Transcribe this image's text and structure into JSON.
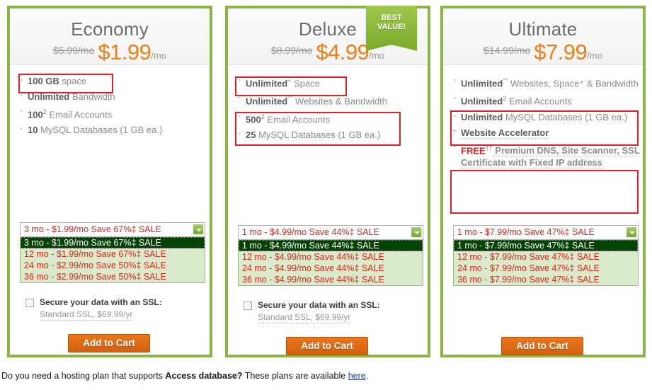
{
  "ribbon": {
    "line1": "BEST",
    "line2": "VALUE!"
  },
  "plans": [
    {
      "id": "economy",
      "name": "Economy",
      "old_price": "$5.99/mo",
      "price": "$1.99",
      "per": "/mo",
      "features": [
        {
          "strong": "100 GB",
          "rest": " space"
        },
        {
          "strong": "Unlimited",
          "rest": " Bandwidth"
        },
        {
          "strong": "100",
          "rest": " Email Accounts",
          "sup": "2"
        },
        {
          "strong": "10",
          "rest": " MySQL Databases (1 GB ea.)"
        }
      ],
      "selected_term": "3 mo   - $1.99/mo Save 67%‡ SALE",
      "terms": [
        "3 mo   - $1.99/mo Save 67%‡ SALE",
        "12 mo - $1.99/mo Save 67%‡ SALE",
        "24 mo - $2.99/mo Save 50%‡ SALE",
        "36 mo - $2.99/mo Save 50%‡ SALE"
      ],
      "ssl_label": "Secure your data with an SSL:",
      "ssl_sub": "Standard SSL, $69.99/yr",
      "cart_label": "Add to Cart"
    },
    {
      "id": "deluxe",
      "name": "Deluxe",
      "old_price": "$8.99/mo",
      "price": "$4.99",
      "per": "/mo",
      "features": [
        {
          "strong": "Unlimited",
          "rest": " Space",
          "sup": "+"
        },
        {
          "strong": "Unlimited",
          "rest": " Websites",
          "sup": "°°",
          "tail": " & Bandwidth"
        },
        {
          "strong": "500",
          "rest": " Email Accounts",
          "sup": "2"
        },
        {
          "strong": "25",
          "rest": " MySQL Databases (1 GB ea.)"
        }
      ],
      "selected_term": "1 mo   - $4.99/mo Save 44%‡ SALE",
      "terms": [
        "1 mo   - $4.99/mo Save 44%‡ SALE",
        "12 mo - $4.99/mo Save 44%‡ SALE",
        "24 mo - $4.99/mo Save 44%‡ SALE",
        "36 mo - $4.99/mo Save 44%‡ SALE"
      ],
      "ssl_label": "Secure your data with an SSL:",
      "ssl_sub": "Standard SSL, $69.99/yr",
      "cart_label": "Add to Cart"
    },
    {
      "id": "ultimate",
      "name": "Ultimate",
      "old_price": "$14.99/mo",
      "price": "$7.99",
      "per": "/mo",
      "features": [
        {
          "strong": "Unlimited",
          "rest": " Websites",
          "sup": "°°",
          "tail": ", Space⁺ & Bandwidth"
        },
        {
          "strong": "Unlimited",
          "rest": " Email Accounts",
          "sup": "2"
        },
        {
          "strong": "Unlimited",
          "rest": " MySQL Databases (1 GB ea.)"
        },
        {
          "strong": "Website Accelerator",
          "rest": "",
          "style": "gray-bold-dotted"
        },
        {
          "strong": "FREE",
          "sup": "††",
          "rest": " Premium DNS, Site Scanner, SSL Certificate with Fixed IP address",
          "style": "red-bold"
        }
      ],
      "selected_term": "1 mo   - $7.99/mo Save 47%‡ SALE",
      "terms": [
        "1 mo   - $7.99/mo Save 47%‡ SALE",
        "12 mo - $7.99/mo Save 47%‡ SALE",
        "24 mo - $7.99/mo Save 47%‡ SALE",
        "36 mo - $7.99/mo Save 47%‡ SALE"
      ],
      "cart_label": "Add to Cart"
    }
  ],
  "footer": {
    "text_before": "Do you need a hosting plan that supports ",
    "bold": "Access database?",
    "text_middle": " These plans are available ",
    "link": "here",
    "text_after": "."
  },
  "colors": {
    "card_border_green": "#8cb644",
    "price_orange": "#f07f13",
    "cart_orange": "#d4600d",
    "annotation_red": "#ee1c25",
    "option_red": "#d9261c",
    "selected_green": "#004400",
    "option_bg_green": "#d9ebcb"
  }
}
